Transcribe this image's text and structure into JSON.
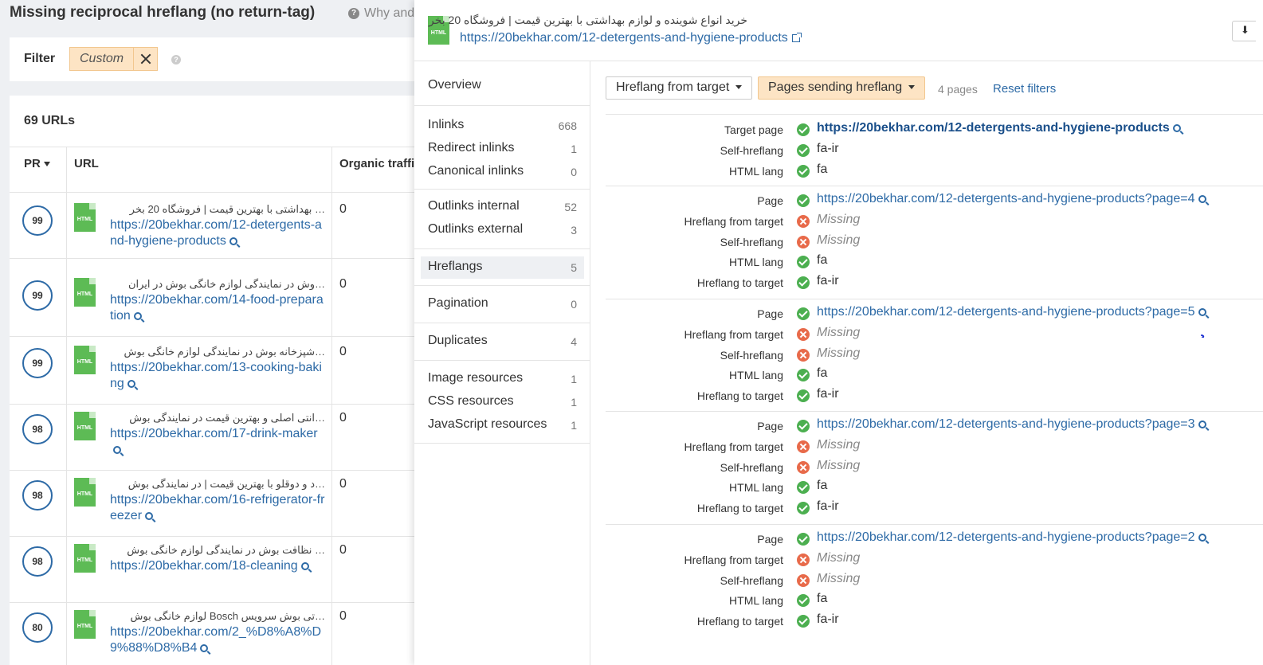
{
  "report": {
    "title": "Missing reciprocal hreflang (no return-tag)",
    "help_text": "Why and",
    "filter_label": "Filter",
    "filter_value": "Custom",
    "url_count": "69 URLs",
    "columns": {
      "pr": "PR",
      "url": "URL",
      "traffic": "Organic traffi"
    },
    "rows": [
      {
        "pr": "99",
        "title": "… بهداشتی با بهترین قیمت | فروشگاه 20 بخر",
        "url": "https://20bekhar.com/12-detergents-and-hygiene-products",
        "traffic": "0"
      },
      {
        "pr": "99",
        "title": "…وش در نمایندگی لوازم خانگی بوش در ایران",
        "url": "https://20bekhar.com/14-food-preparation",
        "traffic": "0"
      },
      {
        "pr": "99",
        "title": "…شپزخانه بوش در نمایندگی لوازم خانگی بوش",
        "url": "https://20bekhar.com/13-cooking-baking",
        "traffic": "0"
      },
      {
        "pr": "98",
        "title": "…انتی اصلی و بهترین قیمت در نمایندگی بوش",
        "url": "https://20bekhar.com/17-drink-maker",
        "traffic": "0"
      },
      {
        "pr": "98",
        "title": "…د و دوقلو با بهترین قیمت | در نمایندگی بوش",
        "url": "https://20bekhar.com/16-refrigerator-freezer",
        "traffic": "0"
      },
      {
        "pr": "98",
        "title": "… نظافت بوش در نمایندگی لوازم خانگی بوش",
        "url": "https://20bekhar.com/18-cleaning",
        "traffic": "0"
      },
      {
        "pr": "80",
        "title": "…تی بوش سرویس Bosch لوازم خانگی بوش",
        "url": "https://20bekhar.com/2_%D8%A8%D9%88%D8%B4",
        "traffic": "0"
      }
    ]
  },
  "drawer": {
    "page_title": "خرید انواع شوینده و لوازم بهداشتی با بهترین قیمت | فروشگاه 20 بخر",
    "page_url": "https://20bekhar.com/12-detergents-and-hygiene-products",
    "file_type": "HTML",
    "nav": [
      {
        "label": "Overview",
        "count": ""
      },
      {
        "label": "Inlinks",
        "count": "668"
      },
      {
        "label": "Redirect inlinks",
        "count": "1"
      },
      {
        "label": "Canonical inlinks",
        "count": "0"
      },
      {
        "label": "Outlinks internal",
        "count": "52"
      },
      {
        "label": "Outlinks external",
        "count": "3"
      },
      {
        "label": "Hreflangs",
        "count": "5"
      },
      {
        "label": "Pagination",
        "count": "0"
      },
      {
        "label": "Duplicates",
        "count": "4"
      },
      {
        "label": "Image resources",
        "count": "1"
      },
      {
        "label": "CSS resources",
        "count": "1"
      },
      {
        "label": "JavaScript resources",
        "count": "1"
      }
    ],
    "toolbar": {
      "dropdown1": "Hreflang from target",
      "dropdown2": "Pages sending hreflang",
      "pages_count": "4 pages",
      "reset": "Reset filters"
    },
    "target_block": {
      "target_page_label": "Target page",
      "target_page": "https://20bekhar.com/12-detergents-and-hygiene-products",
      "self_hreflang_label": "Self-hreflang",
      "self_hreflang": "fa-ir",
      "html_lang_label": "HTML lang",
      "html_lang": "fa"
    },
    "labels": {
      "page": "Page",
      "hreflang_from_target": "Hreflang from target",
      "self_hreflang": "Self-hreflang",
      "html_lang": "HTML lang",
      "hreflang_to_target": "Hreflang to target"
    },
    "pages": [
      {
        "url": "https://20bekhar.com/12-detergents-and-hygiene-products?page=4",
        "hreflang_from_target": "Missing",
        "self_hreflang": "Missing",
        "html_lang": "fa",
        "hreflang_to_target": "fa-ir"
      },
      {
        "url": "https://20bekhar.com/12-detergents-and-hygiene-products?page=5",
        "hreflang_from_target": "Missing",
        "self_hreflang": "Missing",
        "html_lang": "fa",
        "hreflang_to_target": "fa-ir"
      },
      {
        "url": "https://20bekhar.com/12-detergents-and-hygiene-products?page=3",
        "hreflang_from_target": "Missing",
        "self_hreflang": "Missing",
        "html_lang": "fa",
        "hreflang_to_target": "fa-ir"
      },
      {
        "url": "https://20bekhar.com/12-detergents-and-hygiene-products?page=2",
        "hreflang_from_target": "Missing",
        "self_hreflang": "Missing",
        "html_lang": "fa",
        "hreflang_to_target": "fa-ir"
      }
    ],
    "colors": {
      "accent": "#2d6aa6",
      "ok": "#4caf50",
      "error": "#e86a4a",
      "chip": "#fde4c4",
      "annotation": "#1a2fd1"
    }
  }
}
